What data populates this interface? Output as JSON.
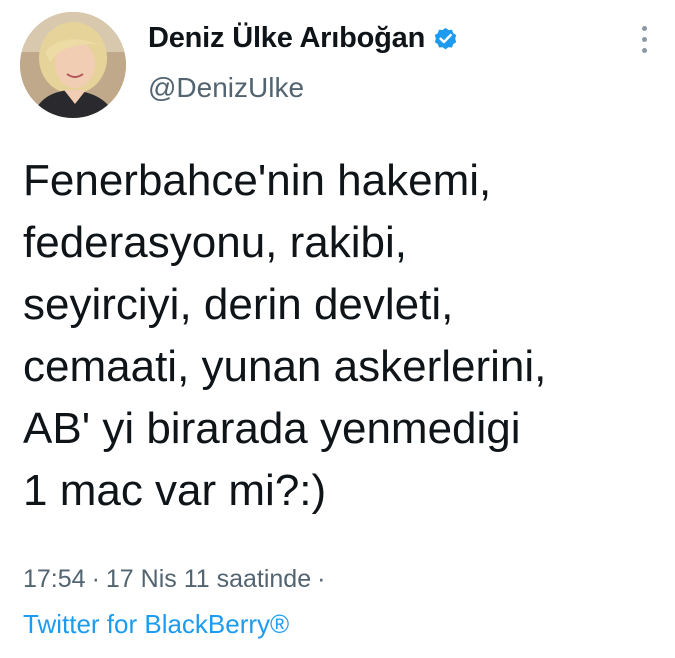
{
  "author": {
    "display_name": "Deniz Ülke Arıboğan",
    "handle": "@DenizUlke",
    "verified": true
  },
  "tweet": {
    "lines": [
      "Fenerbahce'nin hakemi,",
      "federasyonu, rakibi,",
      "seyirciyi, derin devleti,",
      "cemaati, yunan askerlerini,",
      "AB' yi birarada yenmedigi",
      "1 mac var mi?:)"
    ],
    "time": "17:54",
    "separator": "·",
    "date": "17 Nis 11 saatinde",
    "source": "Twitter for BlackBerry®"
  },
  "icons": {
    "verified": "verified-badge-icon",
    "more": "more-vertical-icon"
  },
  "colors": {
    "text": "#0f1419",
    "secondary": "#536471",
    "link": "#1d9bf0"
  }
}
